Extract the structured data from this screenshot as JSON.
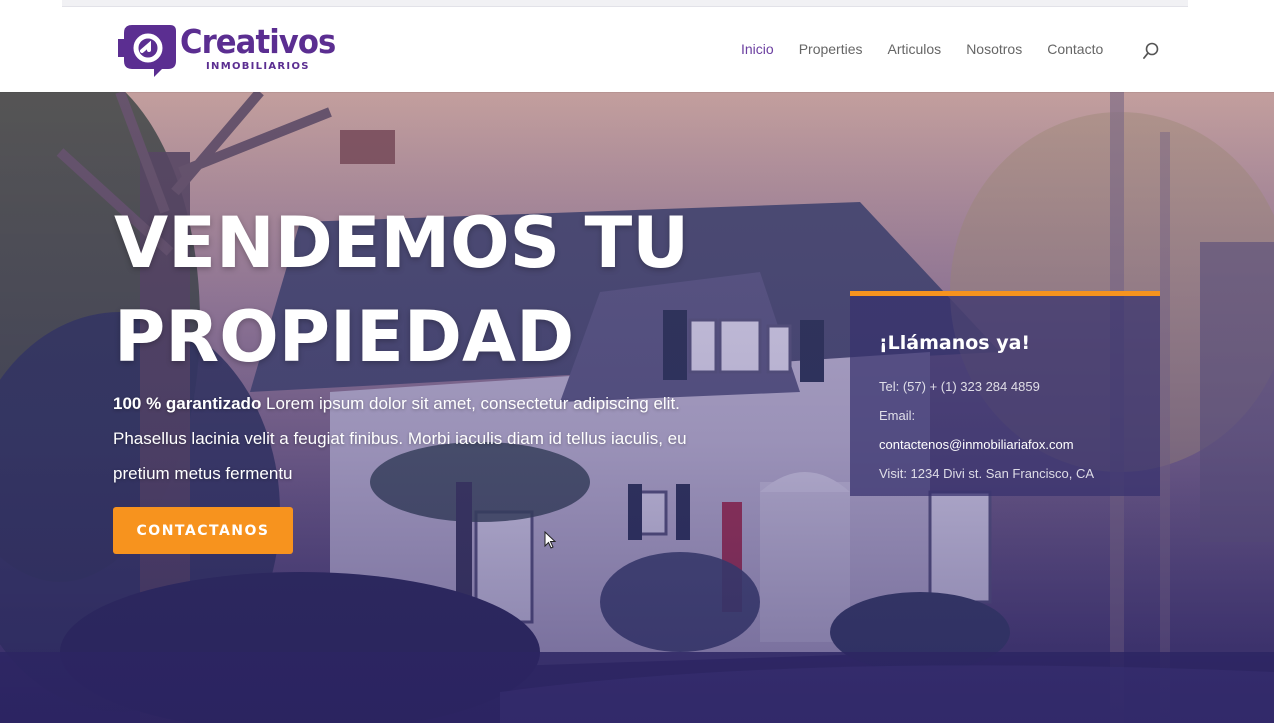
{
  "brand": {
    "name": "Creativos",
    "tagline": "INMOBILIARIOS",
    "color": "#5b2e91"
  },
  "nav": {
    "items": [
      {
        "label": "Inicio",
        "active": true
      },
      {
        "label": "Properties",
        "active": false
      },
      {
        "label": "Articulos",
        "active": false
      },
      {
        "label": "Nosotros",
        "active": false
      },
      {
        "label": "Contacto",
        "active": false
      }
    ],
    "search_icon": "search-icon"
  },
  "hero": {
    "title_line1": "VENDEMOS TU",
    "title_line2": "PROPIEDAD",
    "text_bold": "100 % garantizado",
    "text_line1": " Lorem ipsum dolor sit amet, consectetur adipiscing elit.",
    "text_line2": "Phasellus lacinia velit a feugiat finibus. Morbi iaculis diam id tellus iaculis, eu",
    "text_line3": "pretium metus fermentu",
    "cta_label": "CONTACTANOS",
    "cta_color": "#f7931e"
  },
  "contact_card": {
    "title": "¡Llámanos ya!",
    "phone": "Tel: (57) + (1) 323 284 4859",
    "email_label": "Email:",
    "email": "contactenos@inmobiliariafox.com",
    "visit": "Visit: 1234 Divi st. San Francisco, CA",
    "accent": "#f7931e"
  }
}
